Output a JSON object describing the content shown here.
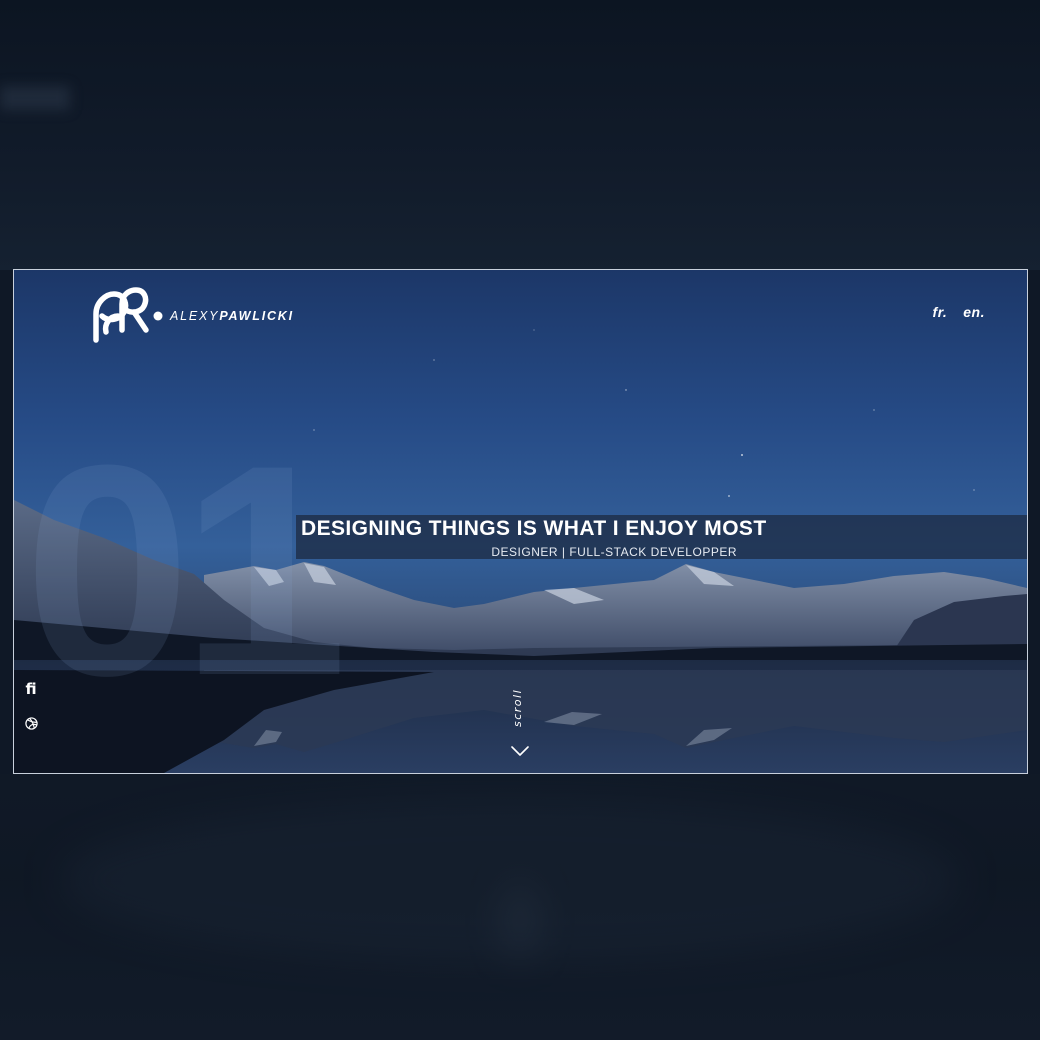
{
  "brand": {
    "first_name": "ALEXY",
    "last_name": "PAWLICKI"
  },
  "languages": [
    "fr.",
    "en."
  ],
  "hero": {
    "number": "01",
    "headline": "DESIGNING THINGS IS WHAT I ENJOY MOST",
    "subheadline": "DESIGNER | FULL-STACK DEVELOPPER"
  },
  "social": {
    "items": [
      {
        "icon": "fi",
        "name": "fi-icon"
      },
      {
        "icon": "dribbble-icon",
        "name": "dribbble-icon"
      }
    ]
  },
  "scroll": {
    "label": "scroll"
  },
  "colors": {
    "sky_top": "#1c3768",
    "sky_mid": "#34609a",
    "page_bg": "#0f1826",
    "headline_bar": "#1c283e",
    "text": "#ffffff"
  }
}
